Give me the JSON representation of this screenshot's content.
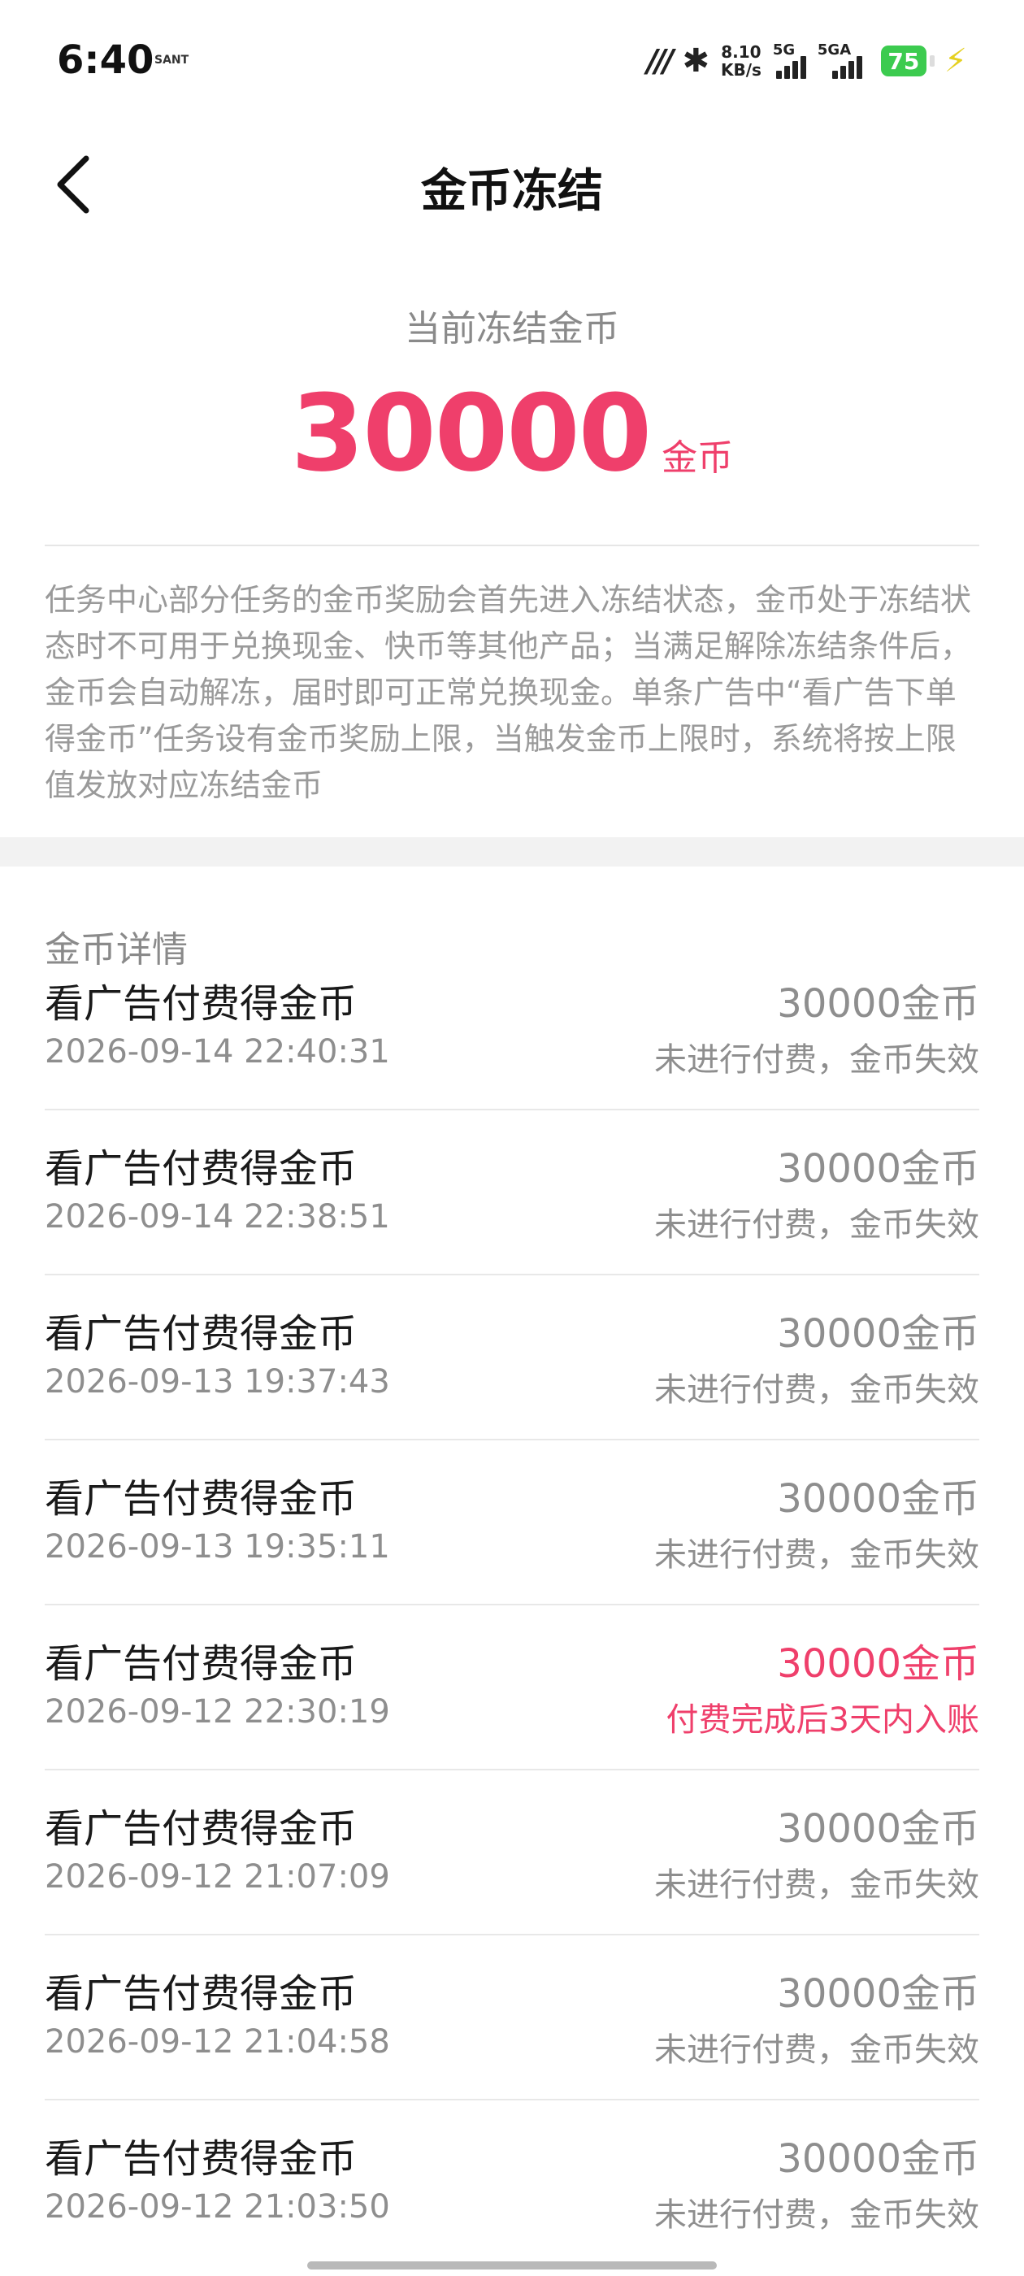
{
  "status_bar": {
    "time": "6:40",
    "app_logo_text": "SANT",
    "carrier_icon": "mi-carrier-icon",
    "net_speed_value": "8.10",
    "net_speed_unit": "KB/s",
    "sim1_label": "5G",
    "sim2_label": "5GA",
    "battery_level": "75"
  },
  "nav": {
    "title": "金币冻结"
  },
  "summary": {
    "label": "当前冻结金币",
    "amount": "30000",
    "unit": "金币"
  },
  "description": "任务中心部分任务的金币奖励会首先进入冻结状态，金币处于冻结状态时不可用于兑换现金、快币等其他产品；当满足解除冻结条件后，金币会自动解冻，届时即可正常兑换现金。单条广告中“看广告下单得金币”任务设有金币奖励上限，当触发金币上限时，系统将按上限值发放对应冻结金币",
  "section_title": "金币详情",
  "colors": {
    "accent": "#ef3f6b",
    "secondary_text": "#8e8e8e",
    "divider": "#e8e8e8"
  },
  "records": [
    {
      "title": "看广告付费得金币",
      "time": "2026-09-14 22:40:31",
      "amount": "30000金币",
      "status": "未进行付费，金币失效",
      "pending": false
    },
    {
      "title": "看广告付费得金币",
      "time": "2026-09-14 22:38:51",
      "amount": "30000金币",
      "status": "未进行付费，金币失效",
      "pending": false
    },
    {
      "title": "看广告付费得金币",
      "time": "2026-09-13 19:37:43",
      "amount": "30000金币",
      "status": "未进行付费，金币失效",
      "pending": false
    },
    {
      "title": "看广告付费得金币",
      "time": "2026-09-13 19:35:11",
      "amount": "30000金币",
      "status": "未进行付费，金币失效",
      "pending": false
    },
    {
      "title": "看广告付费得金币",
      "time": "2026-09-12 22:30:19",
      "amount": "30000金币",
      "status": "付费完成后3天内入账",
      "pending": true
    },
    {
      "title": "看广告付费得金币",
      "time": "2026-09-12 21:07:09",
      "amount": "30000金币",
      "status": "未进行付费，金币失效",
      "pending": false
    },
    {
      "title": "看广告付费得金币",
      "time": "2026-09-12 21:04:58",
      "amount": "30000金币",
      "status": "未进行付费，金币失效",
      "pending": false
    },
    {
      "title": "看广告付费得金币",
      "time": "2026-09-12 21:03:50",
      "amount": "30000金币",
      "status": "未进行付费，金币失效",
      "pending": false
    }
  ]
}
